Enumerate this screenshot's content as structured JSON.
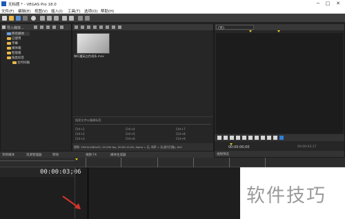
{
  "window": {
    "title": "无标题 * - VEGAS Pro 18.0",
    "minimize_glyph": "−",
    "maximize_glyph": "□",
    "close_glyph": "✕"
  },
  "menubar": {
    "items": [
      "文件(F)",
      "编辑(E)",
      "视图(V)",
      "插入(I)",
      "工具(T)",
      "选项(O)",
      "帮助(H)"
    ]
  },
  "explorer": {
    "header_label": "导入媒体...",
    "tree": [
      "所有媒体",
      "已使用",
      "字幕",
      "媒体箱",
      "智能箱",
      "按类标签",
      "主时间轴"
    ],
    "tabs": [
      "项目媒体",
      "资源管理器",
      "转场"
    ]
  },
  "media_pool": {
    "clip_name": "和IC魔英白色线条.mov",
    "search_placeholder": "搜索文件以编辑标签",
    "shortcuts": [
      "Ctrl+1",
      "Ctrl+4",
      "Ctrl+7",
      "Ctrl+2",
      "Ctrl+5",
      "Ctrl+8",
      "Ctrl+3",
      "Ctrl+6",
      "Ctrl+9"
    ],
    "info_text": "视频: 1920x1080x32, 25.000 fps, 00:00:12;00, Alpha = 无, 场序 = 无(逐行扫描), AVC",
    "tabs": [
      "视频 FX",
      "媒体生成器"
    ]
  },
  "preview": {
    "dropdown_value": "(无)",
    "timecode": "00:00:00;00",
    "end_timecode": "00:00:03;17",
    "tab_label": "视频预览"
  },
  "timeline": {
    "current_time": "00:00:03;06"
  },
  "watermark": "软件技巧",
  "colors": {
    "accent_blue": "#2f7fd8",
    "marker_yellow": "#e8d21a",
    "folder_yellow": "#e8b84a",
    "arrow_red": "#d2342c"
  }
}
